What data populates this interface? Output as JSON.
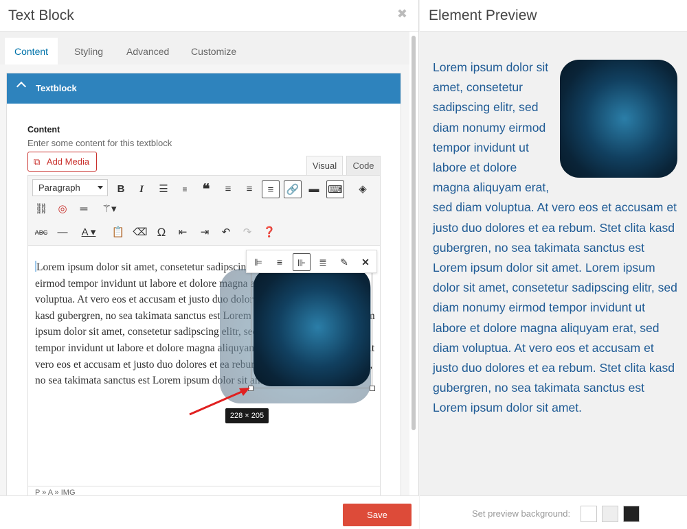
{
  "editor_panel": {
    "title": "Text Block",
    "close_icon": "✖",
    "tabs": [
      {
        "label": "Content",
        "active": true
      },
      {
        "label": "Styling",
        "active": false
      },
      {
        "label": "Advanced",
        "active": false
      },
      {
        "label": "Customize",
        "active": false
      }
    ],
    "section": {
      "title": "Textblock"
    },
    "field": {
      "label": "Content",
      "description": "Enter some content for this textblock"
    },
    "add_media_label": "Add Media",
    "modes": {
      "visual": "Visual",
      "code": "Code"
    },
    "format_select": "Paragraph",
    "content_text": "Lorem ipsum dolor sit amet, consetetur sadipscing elitr, sed diam nonumy eirmod tempor invidunt ut labore et dolore magna aliquyam erat, sed diam voluptua. At vero eos et accusam et justo duo dolores et ea rebum. Stet clita kasd gubergren, no sea takimata sanctus est Lorem ipsum dolor sit amet. Lorem ipsum dolor sit amet, consetetur sadipscing elitr, sed diam nonumy eirmod tempor invidunt ut labore et dolore magna aliquyam erat, sed diam voluptua. At vero eos et accusam et justo duo dolores et ea rebum. Stet clita kasd gubergren, no sea takimata sanctus est Lorem ipsum dolor sit amet.",
    "path_status": "P » A » IMG",
    "image_dimensions": "228 × 205",
    "save_label": "Save"
  },
  "preview_panel": {
    "title": "Element Preview",
    "text": "Lorem ipsum dolor sit amet, consetetur sadipscing elitr, sed diam nonumy eirmod tempor invidunt ut labore et dolore magna aliquyam erat, sed diam voluptua. At vero eos et accusam et justo duo dolores et ea rebum. Stet clita kasd gubergren, no sea takimata sanctus est Lorem ipsum dolor sit amet. Lorem ipsum dolor sit amet, consetetur sadipscing elitr, sed diam nonumy eirmod tempor invidunt ut labore et dolore magna aliquyam erat, sed diam voluptua. At vero eos et accusam et justo duo dolores et ea rebum. Stet clita kasd gubergren, no sea takimata sanctus est Lorem ipsum dolor sit amet.",
    "bg_label": "Set preview background:",
    "swatches": [
      "#ffffff",
      "#eeeeee",
      "#222222"
    ]
  },
  "colors": {
    "accent": "#2e83bd",
    "save": "#dd4b39",
    "preview_text": "#1f5b95"
  }
}
